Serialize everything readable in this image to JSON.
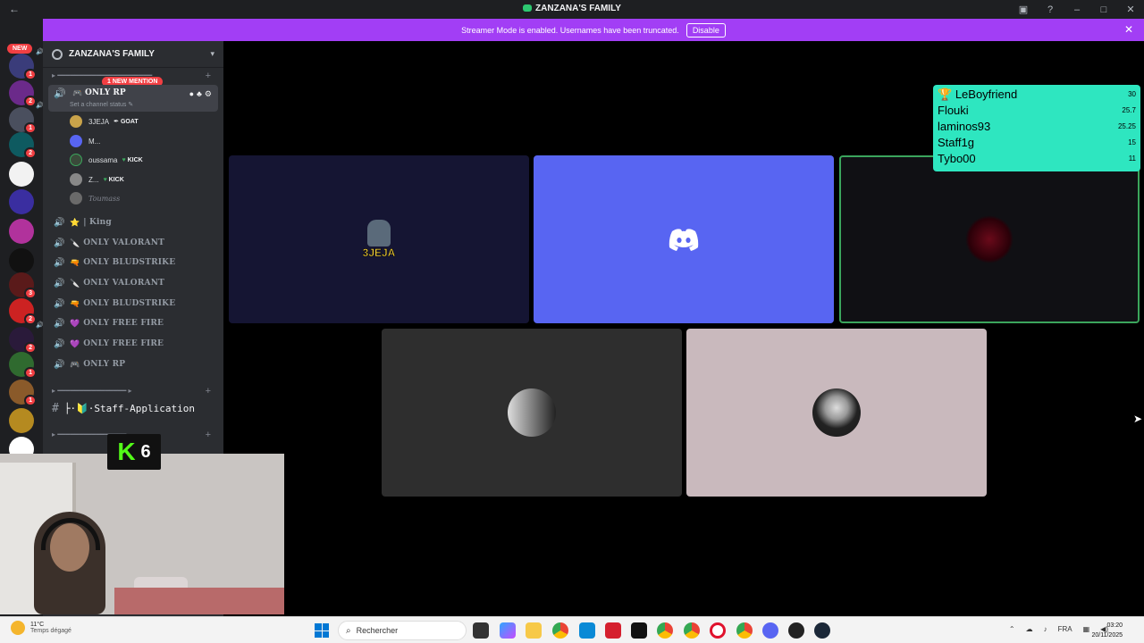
{
  "titlebar": {
    "app_title": "ZANZANA'S FAMILY"
  },
  "rail": {
    "new_badge": "NEW",
    "servers": [
      {
        "badge": "1"
      },
      {
        "badge": "2"
      },
      {
        "badge": "1"
      },
      {
        "badge": "2"
      },
      {
        "badge": ""
      },
      {
        "badge": ""
      },
      {
        "badge": ""
      },
      {
        "badge": ""
      },
      {
        "badge": "3"
      },
      {
        "badge": "2"
      },
      {
        "badge": "2"
      },
      {
        "badge": "1"
      },
      {
        "badge": "1"
      },
      {
        "badge": ""
      },
      {
        "badge": ""
      }
    ]
  },
  "banner": {
    "message": "Streamer Mode is enabled. Usernames have been truncated.",
    "disable_label": "Disable"
  },
  "sidebar": {
    "guild_name": "ZANZANA'S FAMILY",
    "mention_badge": "1 NEW MENTION",
    "active_channel": {
      "name": "ONLY RP",
      "status_placeholder": "Set a channel status"
    },
    "members": [
      {
        "name": "3JEJA",
        "tag": "GOAT"
      },
      {
        "name": "M...",
        "tag": ""
      },
      {
        "name": "oussama",
        "tag": "KICK"
      },
      {
        "name": "Z...",
        "tag": "KICK"
      },
      {
        "name": "Toumass",
        "tag": ""
      }
    ],
    "voice_channels": [
      {
        "emoji": "⭐",
        "label": "| King"
      },
      {
        "emoji": "🔪",
        "label": "ONLY VALORANT"
      },
      {
        "emoji": "🔫",
        "label": "ONLY BLUDSTRIKE"
      },
      {
        "emoji": "🔪",
        "label": "ONLY VALORANT"
      },
      {
        "emoji": "🔫",
        "label": "ONLY BLUDSTRIKE"
      },
      {
        "emoji": "💜",
        "label": "ONLY FREE FIRE"
      },
      {
        "emoji": "💜",
        "label": "ONLY FREE FIRE"
      },
      {
        "emoji": "🎮",
        "label": "ONLY RP"
      }
    ],
    "text_channel": "├·🔰·Staff-Application"
  },
  "stage": {
    "tiles": [
      {
        "label": "3JEJA"
      }
    ]
  },
  "leaderboard": {
    "rows": [
      {
        "name": "LeBoyfriend",
        "score": "30"
      },
      {
        "name": "Flouki",
        "score": "25.7"
      },
      {
        "name": "laminos93",
        "score": "25.25"
      },
      {
        "name": "Staff1g",
        "score": "15"
      },
      {
        "name": "Tybo00",
        "score": "11"
      }
    ]
  },
  "webcam": {
    "kick_count": "6"
  },
  "taskbar": {
    "weather_temp": "11°C",
    "weather_desc": "Temps dégagé",
    "search_placeholder": "Rechercher",
    "lang": "FRA",
    "time": "03:20",
    "date": "20/11/2025"
  },
  "colors": {
    "banner": "#a23ef5",
    "discord_blurple": "#5865f2",
    "leaderboard": "#2ee6c0",
    "badge_red": "#f23f43"
  }
}
